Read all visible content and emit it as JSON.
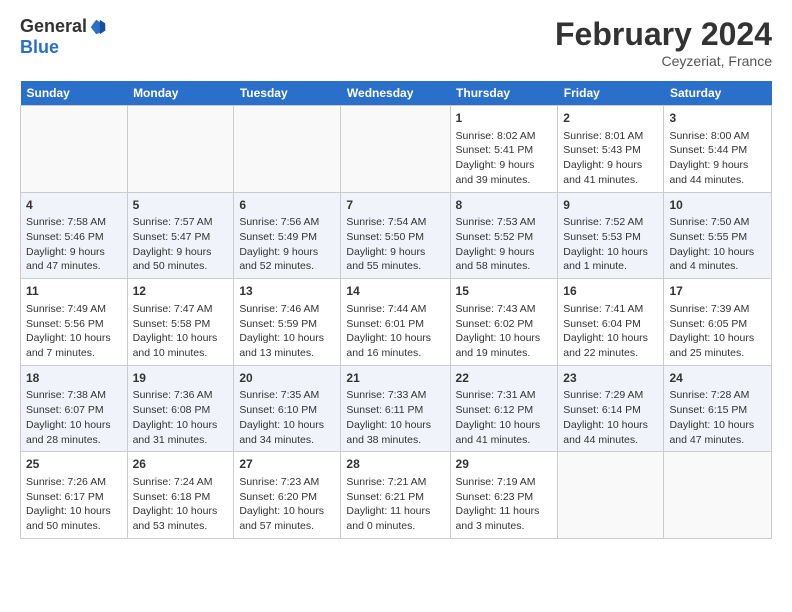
{
  "header": {
    "logo_general": "General",
    "logo_blue": "Blue",
    "title": "February 2024",
    "location": "Ceyzeriat, France"
  },
  "days_of_week": [
    "Sunday",
    "Monday",
    "Tuesday",
    "Wednesday",
    "Thursday",
    "Friday",
    "Saturday"
  ],
  "weeks": [
    [
      {
        "day": "",
        "sunrise": "",
        "sunset": "",
        "daylight": "",
        "empty": true
      },
      {
        "day": "",
        "sunrise": "",
        "sunset": "",
        "daylight": "",
        "empty": true
      },
      {
        "day": "",
        "sunrise": "",
        "sunset": "",
        "daylight": "",
        "empty": true
      },
      {
        "day": "",
        "sunrise": "",
        "sunset": "",
        "daylight": "",
        "empty": true
      },
      {
        "day": "1",
        "sunrise": "Sunrise: 8:02 AM",
        "sunset": "Sunset: 5:41 PM",
        "daylight": "Daylight: 9 hours and 39 minutes.",
        "empty": false
      },
      {
        "day": "2",
        "sunrise": "Sunrise: 8:01 AM",
        "sunset": "Sunset: 5:43 PM",
        "daylight": "Daylight: 9 hours and 41 minutes.",
        "empty": false
      },
      {
        "day": "3",
        "sunrise": "Sunrise: 8:00 AM",
        "sunset": "Sunset: 5:44 PM",
        "daylight": "Daylight: 9 hours and 44 minutes.",
        "empty": false
      }
    ],
    [
      {
        "day": "4",
        "sunrise": "Sunrise: 7:58 AM",
        "sunset": "Sunset: 5:46 PM",
        "daylight": "Daylight: 9 hours and 47 minutes.",
        "empty": false
      },
      {
        "day": "5",
        "sunrise": "Sunrise: 7:57 AM",
        "sunset": "Sunset: 5:47 PM",
        "daylight": "Daylight: 9 hours and 50 minutes.",
        "empty": false
      },
      {
        "day": "6",
        "sunrise": "Sunrise: 7:56 AM",
        "sunset": "Sunset: 5:49 PM",
        "daylight": "Daylight: 9 hours and 52 minutes.",
        "empty": false
      },
      {
        "day": "7",
        "sunrise": "Sunrise: 7:54 AM",
        "sunset": "Sunset: 5:50 PM",
        "daylight": "Daylight: 9 hours and 55 minutes.",
        "empty": false
      },
      {
        "day": "8",
        "sunrise": "Sunrise: 7:53 AM",
        "sunset": "Sunset: 5:52 PM",
        "daylight": "Daylight: 9 hours and 58 minutes.",
        "empty": false
      },
      {
        "day": "9",
        "sunrise": "Sunrise: 7:52 AM",
        "sunset": "Sunset: 5:53 PM",
        "daylight": "Daylight: 10 hours and 1 minute.",
        "empty": false
      },
      {
        "day": "10",
        "sunrise": "Sunrise: 7:50 AM",
        "sunset": "Sunset: 5:55 PM",
        "daylight": "Daylight: 10 hours and 4 minutes.",
        "empty": false
      }
    ],
    [
      {
        "day": "11",
        "sunrise": "Sunrise: 7:49 AM",
        "sunset": "Sunset: 5:56 PM",
        "daylight": "Daylight: 10 hours and 7 minutes.",
        "empty": false
      },
      {
        "day": "12",
        "sunrise": "Sunrise: 7:47 AM",
        "sunset": "Sunset: 5:58 PM",
        "daylight": "Daylight: 10 hours and 10 minutes.",
        "empty": false
      },
      {
        "day": "13",
        "sunrise": "Sunrise: 7:46 AM",
        "sunset": "Sunset: 5:59 PM",
        "daylight": "Daylight: 10 hours and 13 minutes.",
        "empty": false
      },
      {
        "day": "14",
        "sunrise": "Sunrise: 7:44 AM",
        "sunset": "Sunset: 6:01 PM",
        "daylight": "Daylight: 10 hours and 16 minutes.",
        "empty": false
      },
      {
        "day": "15",
        "sunrise": "Sunrise: 7:43 AM",
        "sunset": "Sunset: 6:02 PM",
        "daylight": "Daylight: 10 hours and 19 minutes.",
        "empty": false
      },
      {
        "day": "16",
        "sunrise": "Sunrise: 7:41 AM",
        "sunset": "Sunset: 6:04 PM",
        "daylight": "Daylight: 10 hours and 22 minutes.",
        "empty": false
      },
      {
        "day": "17",
        "sunrise": "Sunrise: 7:39 AM",
        "sunset": "Sunset: 6:05 PM",
        "daylight": "Daylight: 10 hours and 25 minutes.",
        "empty": false
      }
    ],
    [
      {
        "day": "18",
        "sunrise": "Sunrise: 7:38 AM",
        "sunset": "Sunset: 6:07 PM",
        "daylight": "Daylight: 10 hours and 28 minutes.",
        "empty": false
      },
      {
        "day": "19",
        "sunrise": "Sunrise: 7:36 AM",
        "sunset": "Sunset: 6:08 PM",
        "daylight": "Daylight: 10 hours and 31 minutes.",
        "empty": false
      },
      {
        "day": "20",
        "sunrise": "Sunrise: 7:35 AM",
        "sunset": "Sunset: 6:10 PM",
        "daylight": "Daylight: 10 hours and 34 minutes.",
        "empty": false
      },
      {
        "day": "21",
        "sunrise": "Sunrise: 7:33 AM",
        "sunset": "Sunset: 6:11 PM",
        "daylight": "Daylight: 10 hours and 38 minutes.",
        "empty": false
      },
      {
        "day": "22",
        "sunrise": "Sunrise: 7:31 AM",
        "sunset": "Sunset: 6:12 PM",
        "daylight": "Daylight: 10 hours and 41 minutes.",
        "empty": false
      },
      {
        "day": "23",
        "sunrise": "Sunrise: 7:29 AM",
        "sunset": "Sunset: 6:14 PM",
        "daylight": "Daylight: 10 hours and 44 minutes.",
        "empty": false
      },
      {
        "day": "24",
        "sunrise": "Sunrise: 7:28 AM",
        "sunset": "Sunset: 6:15 PM",
        "daylight": "Daylight: 10 hours and 47 minutes.",
        "empty": false
      }
    ],
    [
      {
        "day": "25",
        "sunrise": "Sunrise: 7:26 AM",
        "sunset": "Sunset: 6:17 PM",
        "daylight": "Daylight: 10 hours and 50 minutes.",
        "empty": false
      },
      {
        "day": "26",
        "sunrise": "Sunrise: 7:24 AM",
        "sunset": "Sunset: 6:18 PM",
        "daylight": "Daylight: 10 hours and 53 minutes.",
        "empty": false
      },
      {
        "day": "27",
        "sunrise": "Sunrise: 7:23 AM",
        "sunset": "Sunset: 6:20 PM",
        "daylight": "Daylight: 10 hours and 57 minutes.",
        "empty": false
      },
      {
        "day": "28",
        "sunrise": "Sunrise: 7:21 AM",
        "sunset": "Sunset: 6:21 PM",
        "daylight": "Daylight: 11 hours and 0 minutes.",
        "empty": false
      },
      {
        "day": "29",
        "sunrise": "Sunrise: 7:19 AM",
        "sunset": "Sunset: 6:23 PM",
        "daylight": "Daylight: 11 hours and 3 minutes.",
        "empty": false
      },
      {
        "day": "",
        "sunrise": "",
        "sunset": "",
        "daylight": "",
        "empty": true
      },
      {
        "day": "",
        "sunrise": "",
        "sunset": "",
        "daylight": "",
        "empty": true
      }
    ]
  ]
}
